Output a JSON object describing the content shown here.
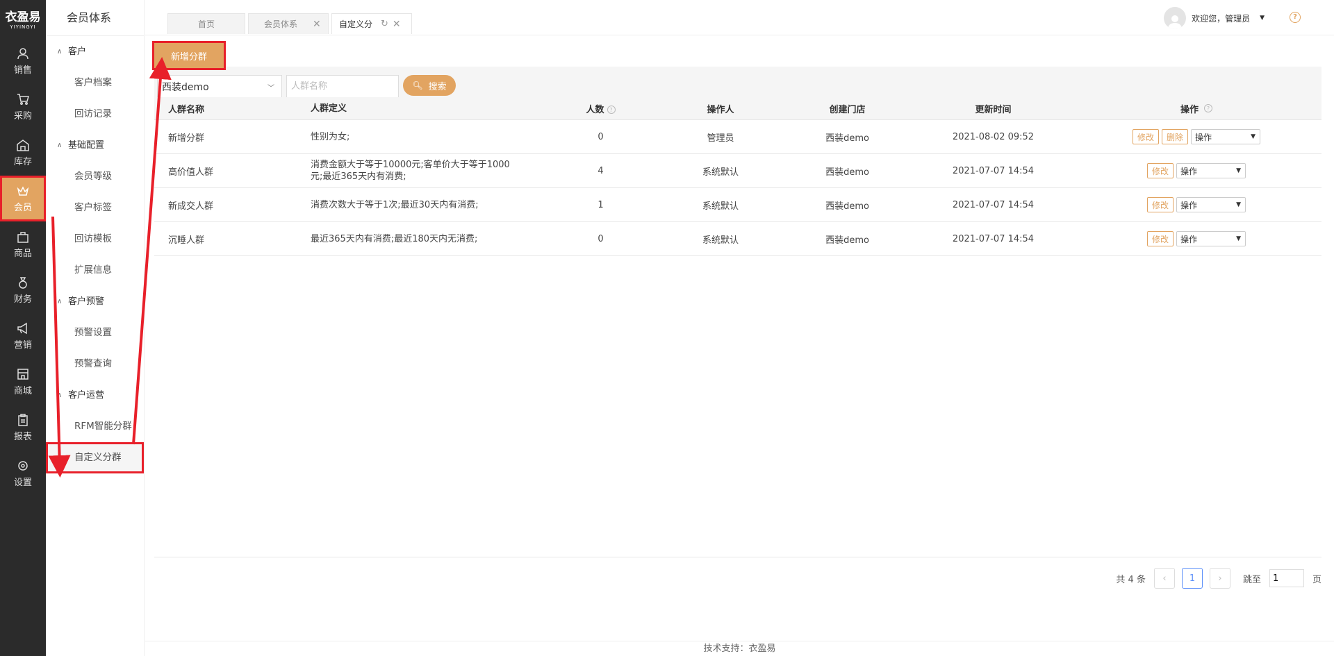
{
  "logo": {
    "title": "衣盈易",
    "subtitle": "YIYINGYI"
  },
  "nav": [
    {
      "label": "销售",
      "icon": "user-icon"
    },
    {
      "label": "采购",
      "icon": "cart-icon"
    },
    {
      "label": "库存",
      "icon": "warehouse-icon"
    },
    {
      "label": "会员",
      "icon": "crown-icon",
      "active": true
    },
    {
      "label": "商品",
      "icon": "bag-icon"
    },
    {
      "label": "财务",
      "icon": "money-bag-icon"
    },
    {
      "label": "营销",
      "icon": "megaphone-icon"
    },
    {
      "label": "商城",
      "icon": "shop-icon"
    },
    {
      "label": "报表",
      "icon": "clipboard-icon"
    },
    {
      "label": "设置",
      "icon": "gear-icon"
    }
  ],
  "submenu": {
    "title": "会员体系",
    "groups": [
      {
        "label": "客户",
        "items": [
          "客户档案",
          "回访记录"
        ]
      },
      {
        "label": "基础配置",
        "items": [
          "会员等级",
          "客户标签",
          "回访模板",
          "扩展信息"
        ]
      },
      {
        "label": "客户预警",
        "items": [
          "预警设置",
          "预警查询"
        ]
      },
      {
        "label": "客户运营",
        "items": [
          "RFM智能分群",
          "自定义分群"
        ]
      }
    ],
    "active_item": "自定义分群"
  },
  "tabs": [
    {
      "label": "首页"
    },
    {
      "label": "会员体系"
    },
    {
      "label": "自定义分",
      "active": true
    }
  ],
  "user": {
    "greeting": "欢迎您，管理员"
  },
  "toolbar": {
    "add_label": "新增分群"
  },
  "filter": {
    "store_value": "西装demo",
    "name_placeholder": "人群名称",
    "search_label": "搜索"
  },
  "table": {
    "headers": {
      "name": "人群名称",
      "definition": "人群定义",
      "count": "人数",
      "operator": "操作人",
      "store": "创建门店",
      "updated": "更新时间",
      "actions": "操作"
    },
    "rows": [
      {
        "name": "新增分群",
        "definition": "性别为女;",
        "count": "0",
        "operator": "管理员",
        "store": "西装demo",
        "updated": "2021-08-02 09:52",
        "edit": "修改",
        "delete": "删除",
        "op_select": "操作"
      },
      {
        "name": "高价值人群",
        "definition": "消费金额大于等于10000元;客单价大于等于1000元;最近365天内有消费;",
        "count": "4",
        "operator": "系统默认",
        "store": "西装demo",
        "updated": "2021-07-07 14:54",
        "edit": "修改",
        "op_select": "操作"
      },
      {
        "name": "新成交人群",
        "definition": "消费次数大于等于1次;最近30天内有消费;",
        "count": "1",
        "operator": "系统默认",
        "store": "西装demo",
        "updated": "2021-07-07 14:54",
        "edit": "修改",
        "op_select": "操作"
      },
      {
        "name": "沉睡人群",
        "definition": "最近365天内有消费;最近180天内无消费;",
        "count": "0",
        "operator": "系统默认",
        "store": "西装demo",
        "updated": "2021-07-07 14:54",
        "edit": "修改",
        "op_select": "操作"
      }
    ]
  },
  "pager": {
    "total": "共 4 条",
    "current": "1",
    "jump_label": "跳至",
    "jump_value": "1",
    "page_suffix": "页"
  },
  "footer": {
    "text": "技术支持：衣盈易"
  },
  "colors": {
    "accent": "#e2a461",
    "highlight": "#e8202a",
    "nav_bg": "#2b2b2b"
  }
}
